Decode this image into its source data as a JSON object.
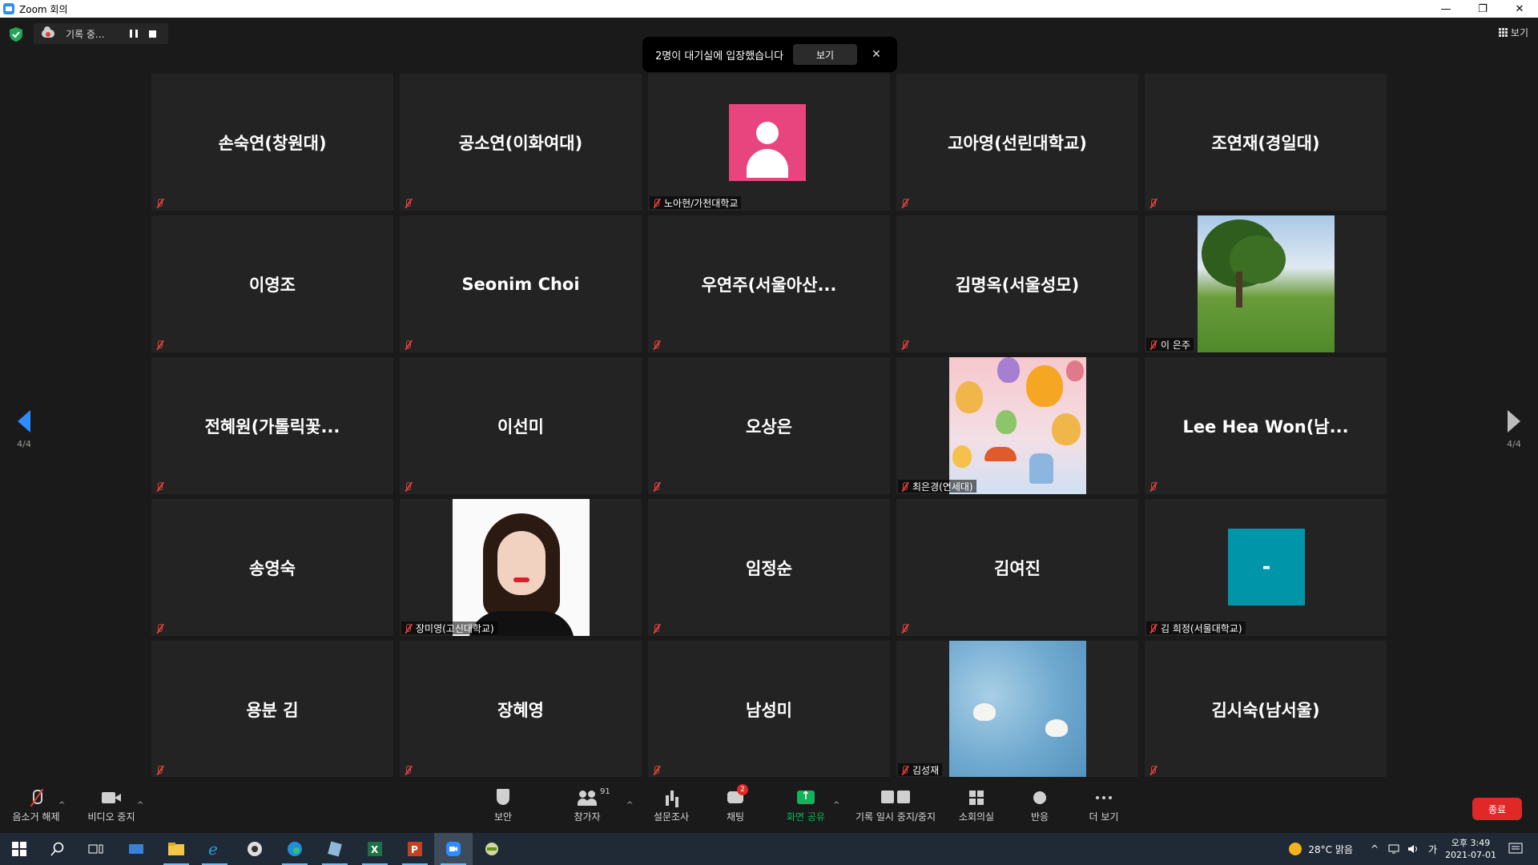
{
  "window": {
    "title": "Zoom 회의"
  },
  "recording": {
    "label": "기록 중..."
  },
  "notification": {
    "text": "2명이 대기실에 입장했습니다",
    "button": "보기"
  },
  "view": {
    "label": "보기"
  },
  "pagination": {
    "left": "4/4",
    "right": "4/4"
  },
  "participants": [
    {
      "name": "손숙연(창원대)",
      "type": "name"
    },
    {
      "name": "공소연(이화여대)",
      "type": "name"
    },
    {
      "label": "노아현/가천대학교",
      "type": "avatar-pink"
    },
    {
      "name": "고아영(선린대학교)",
      "type": "name"
    },
    {
      "name": "조연재(경일대)",
      "type": "name"
    },
    {
      "name": "이영조",
      "type": "name"
    },
    {
      "name": "Seonim Choi",
      "type": "name"
    },
    {
      "name": "우연주(서울아산...",
      "type": "name"
    },
    {
      "name": "김명옥(서울성모)",
      "type": "name"
    },
    {
      "label": "이 은주",
      "type": "photo-tree"
    },
    {
      "name": "전혜원(가톨릭꽃...",
      "type": "name"
    },
    {
      "name": "이선미",
      "type": "name"
    },
    {
      "name": "오상은",
      "type": "name"
    },
    {
      "label": "최은경(연세대)",
      "type": "photo-balloons"
    },
    {
      "name": "Lee Hea Won(남...",
      "type": "name"
    },
    {
      "name": "송영숙",
      "type": "name"
    },
    {
      "label": "장미영(고신대학교)",
      "type": "photo-woman"
    },
    {
      "name": "임정순",
      "type": "name"
    },
    {
      "name": "김여진",
      "type": "name"
    },
    {
      "label": "김 희정(서울대학교)",
      "type": "avatar-teal",
      "avatar_text": "-"
    },
    {
      "name": "용분 김",
      "type": "name"
    },
    {
      "name": "장혜영",
      "type": "name"
    },
    {
      "name": "남성미",
      "type": "name"
    },
    {
      "label": "김성재",
      "type": "photo-lotus"
    },
    {
      "name": "김시숙(남서울)",
      "type": "name"
    }
  ],
  "toolbar": {
    "unmute": "음소거 해제",
    "stop_video": "비디오 중지",
    "security": "보안",
    "participants": "참가자",
    "participants_count": "91",
    "polls": "설문조사",
    "chat": "채팅",
    "chat_badge": "2",
    "share": "화면 공유",
    "rec_pause": "기록 일시 중지/중지",
    "breakout": "소회의실",
    "reactions": "반응",
    "more": "더 보기",
    "end": "종료"
  },
  "taskbar": {
    "weather": "28°C  맑음",
    "ime": "가",
    "time": "오후 3:49",
    "date": "2021-07-01"
  },
  "colors": {
    "accent": "#2d8cff",
    "end": "#e02828",
    "share": "#12b35a",
    "muted": "#e0403a"
  }
}
